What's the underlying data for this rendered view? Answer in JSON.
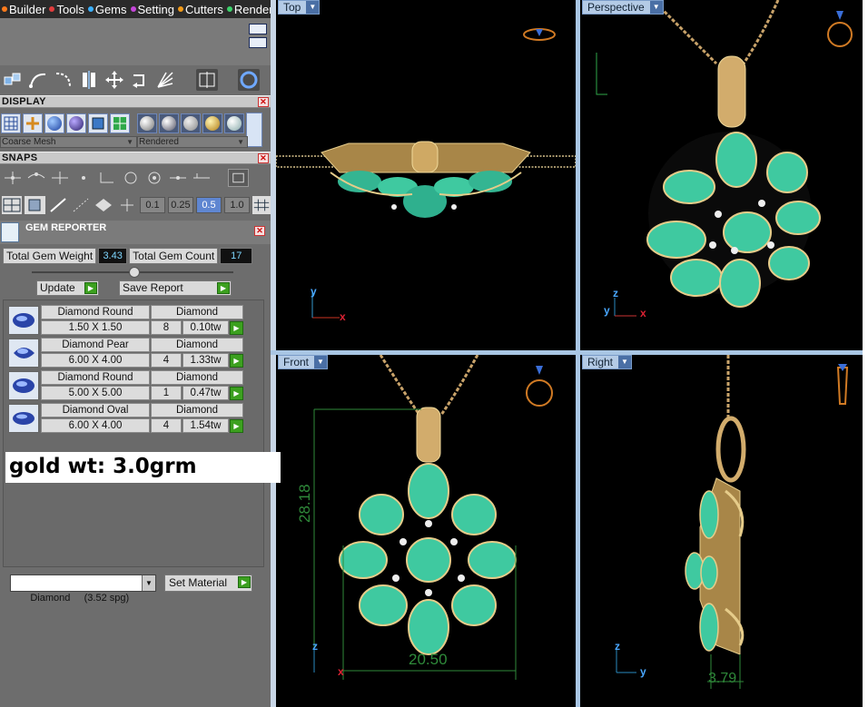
{
  "menu": {
    "items": [
      {
        "label": "Builder",
        "color": "#ff7b1c"
      },
      {
        "label": "Tools",
        "color": "#e23d3d"
      },
      {
        "label": "Gems",
        "color": "#3bb0ff"
      },
      {
        "label": "Setting",
        "color": "#c546d9"
      },
      {
        "label": "Cutters",
        "color": "#f19a19"
      },
      {
        "label": "Render",
        "color": "#3bd16a"
      }
    ]
  },
  "toolbar": {
    "icons": [
      "cubes-icon",
      "curve-arrow-icon",
      "trim-curve-icon",
      "mirror-icon",
      "move-icon",
      "rotate-arrow-icon",
      "array-icon",
      "split-view-icon",
      "ring-view-icon"
    ]
  },
  "display": {
    "title": "DISPLAY",
    "mesh_mode": "Coarse Mesh",
    "render_mode": "Rendered"
  },
  "snaps": {
    "title": "SNAPS",
    "grid_values": [
      "0.1",
      "0.25",
      "0.5",
      "1.0"
    ],
    "active_grid": "0.5"
  },
  "gem_reporter": {
    "title": "GEM REPORTER",
    "total_weight_label": "Total Gem Weight",
    "total_weight": "3.43",
    "total_count_label": "Total Gem Count",
    "total_count": "17",
    "update_label": "Update",
    "save_report_label": "Save Report",
    "gems": [
      {
        "cut": "Diamond Round",
        "material": "Diamond",
        "size": "1.50 X 1.50",
        "count": "8",
        "weight": "0.10tw"
      },
      {
        "cut": "Diamond Pear",
        "material": "Diamond",
        "size": "6.00 X 4.00",
        "count": "4",
        "weight": "1.33tw"
      },
      {
        "cut": "Diamond Round",
        "material": "Diamond",
        "size": "5.00 X 5.00",
        "count": "1",
        "weight": "0.47tw"
      },
      {
        "cut": "Diamond Oval",
        "material": "Diamond",
        "size": "6.00 X 4.00",
        "count": "4",
        "weight": "1.54tw"
      }
    ]
  },
  "gold_note": "gold wt: 3.0grm",
  "material": {
    "selected": "Diamond     (3.52 spg)",
    "set_label": "Set Material"
  },
  "viewports": {
    "top": {
      "label": "Top"
    },
    "perspective": {
      "label": "Perspective"
    },
    "front": {
      "label": "Front",
      "height_dim": "28.18",
      "width_dim": "20.50"
    },
    "right": {
      "label": "Right",
      "depth_dim": "3.79"
    }
  },
  "axes": {
    "x": "x",
    "y": "y",
    "z": "z"
  },
  "colors": {
    "gold": "#c9a36a",
    "gem": "#46c9a8",
    "dim_line": "#2f8a3a",
    "viewport_bg": "#000000"
  }
}
